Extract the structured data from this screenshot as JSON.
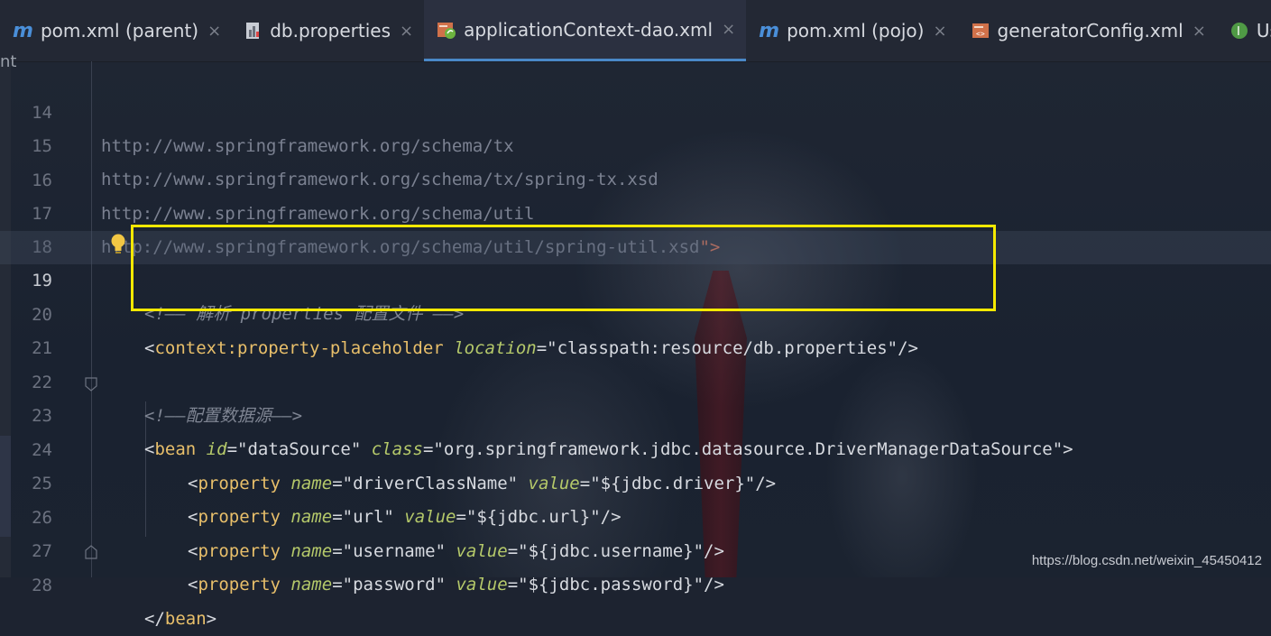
{
  "tabs": [
    {
      "label": "pom.xml (parent)",
      "icon": "maven-icon",
      "active": false
    },
    {
      "label": "db.properties",
      "icon": "properties-file-icon",
      "active": false
    },
    {
      "label": "applicationContext-dao.xml",
      "icon": "spring-xml-icon",
      "active": true
    },
    {
      "label": "pom.xml (pojo)",
      "icon": "maven-icon",
      "active": false
    },
    {
      "label": "generatorConfig.xml",
      "icon": "xml-config-icon",
      "active": false
    },
    {
      "label": "UsersM",
      "icon": "interface-icon",
      "active": false
    }
  ],
  "tab_close_glyph": "×",
  "left_clip_text": "nt",
  "current_line": 19,
  "lines": [
    {
      "n": "14"
    },
    {
      "n": "15"
    },
    {
      "n": "16"
    },
    {
      "n": "17"
    },
    {
      "n": "18"
    },
    {
      "n": "19"
    },
    {
      "n": "20"
    },
    {
      "n": "21"
    },
    {
      "n": "22"
    },
    {
      "n": "23"
    },
    {
      "n": "24"
    },
    {
      "n": "25"
    },
    {
      "n": "26"
    },
    {
      "n": "27"
    },
    {
      "n": "28"
    }
  ],
  "code": {
    "l14": "http://www.springframework.org/schema/tx",
    "l15": "http://www.springframework.org/schema/tx/spring-tx.xsd",
    "l16": "http://www.springframework.org/schema/util",
    "l17": "http://www.springframework.org/schema/util/spring-util.xsd",
    "l17_end": "\">",
    "l19_comment": "<!—— 解析 properties 配置文件 ——>",
    "l20_open": "<",
    "l20_tag": "context:property-placeholder",
    "l20_attr": "location",
    "l20_eq": "=",
    "l20_val": "\"classpath:resource/db.properties\"",
    "l20_close": "/>",
    "l22_comment": "<!——配置数据源——>",
    "l23_open": "<",
    "l23_tag": "bean",
    "l23_attr1": "id",
    "l23_val1": "=\"dataSource\"",
    "l23_attr2": "class",
    "l23_val2": "=\"org.springframework.jdbc.datasource.DriverManagerDataSource\"",
    "l23_close": ">",
    "prop_tag": "property",
    "name_attr": "name",
    "value_attr": "value",
    "l24_name": "=\"driverClassName\"",
    "l24_value": "=\"${jdbc.driver}\"",
    "l25_name": "=\"url\"",
    "l25_value": "=\"${jdbc.url}\"",
    "l26_name": "=\"username\"",
    "l26_value": "=\"${jdbc.username}\"",
    "l27_name": "=\"password\"",
    "l27_value": "=\"${jdbc.password}\"",
    "selfclose": "/>",
    "lt": "<",
    "l28_close_open": "</",
    "l28_tag": "bean",
    "l28_gt": ">"
  },
  "watermark": "https://blog.csdn.net/weixin_45450412",
  "colors": {
    "highlight": "#f5e900",
    "tag": "#e8bf6a",
    "attr": "#b5c96a",
    "active_tab_underline": "#4a88c7"
  }
}
